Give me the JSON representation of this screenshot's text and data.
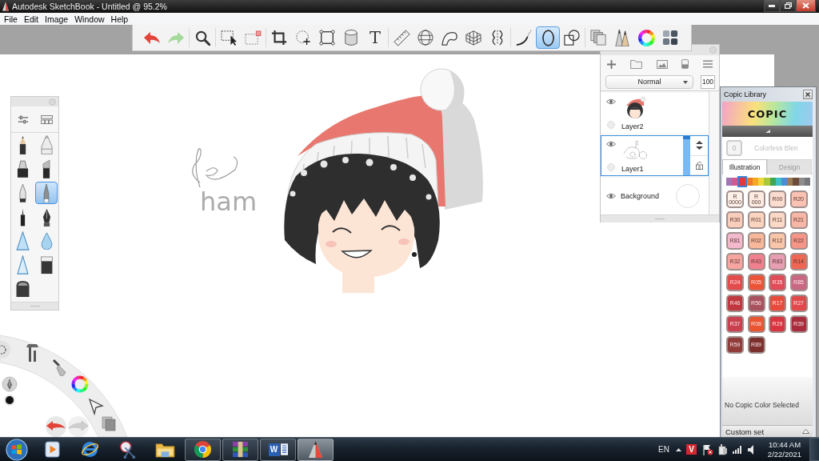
{
  "window": {
    "title": "Autodesk SketchBook - Untitled @ 95.2%"
  },
  "menu": [
    "File",
    "Edit",
    "Image",
    "Window",
    "Help"
  ],
  "toolbar": {
    "groups": [
      [
        {
          "selected": false
        },
        {
          "selected": false
        }
      ],
      [
        {
          "selected": false
        }
      ],
      [
        {
          "selected": false
        },
        {
          "selected": false
        }
      ],
      [
        {
          "selected": false
        },
        {
          "selected": false
        },
        {
          "selected": false
        },
        {
          "selected": false
        },
        {
          "glyph": "T",
          "selected": false
        }
      ],
      [
        {
          "selected": false
        },
        {
          "selected": false
        },
        {
          "selected": false
        },
        {
          "selected": false
        },
        {
          "selected": false
        }
      ],
      [
        {
          "selected": false
        },
        {
          "selected": true
        },
        {
          "selected": false
        }
      ],
      [
        {
          "selected": false
        },
        {
          "selected": false
        },
        {
          "selected": false
        },
        {
          "selected": false
        }
      ]
    ]
  },
  "canvas": {
    "handwriting": "ham"
  },
  "brush_palette": {
    "brushes": [
      {
        "selected": false
      },
      {
        "selected": false
      },
      {
        "selected": false
      },
      {
        "selected": false
      },
      {
        "selected": false
      },
      {
        "selected": true
      },
      {
        "selected": false
      },
      {
        "selected": false
      },
      {
        "selected": false
      },
      {
        "selected": false
      },
      {
        "selected": false
      },
      {
        "selected": false
      },
      {
        "selected": false
      }
    ]
  },
  "layers": {
    "blend_mode": "Normal",
    "opacity": "100",
    "items": [
      {
        "kind": "layer",
        "name": "Layer2",
        "selected": false
      },
      {
        "kind": "layer",
        "name": "Layer1",
        "selected": true
      },
      {
        "kind": "background",
        "name": "Background",
        "selected": false
      }
    ]
  },
  "copic_library": {
    "title": "Copic Library",
    "logo": "COPIC",
    "blender": {
      "code": "0",
      "name": "Colorless Blen",
      "disabled": true
    },
    "tabs": [
      {
        "label": "Illustration",
        "selected": true
      },
      {
        "label": "Design",
        "selected": false
      }
    ],
    "families": [
      {
        "color": "#a274b5",
        "selected": false
      },
      {
        "color": "#cf5b91",
        "selected": false
      },
      {
        "color": "#e2393f",
        "selected": true
      },
      {
        "color": "#f07a2a",
        "selected": false
      },
      {
        "color": "#f5a623",
        "selected": false
      },
      {
        "color": "#efd83a",
        "selected": false
      },
      {
        "color": "#a9c93c",
        "selected": false
      },
      {
        "color": "#3fa654",
        "selected": false
      },
      {
        "color": "#3cc0c6",
        "selected": false
      },
      {
        "color": "#4a8ed1",
        "selected": false
      },
      {
        "color": "#9b7c55",
        "selected": false
      },
      {
        "color": "#6d4b3a",
        "selected": false
      },
      {
        "color": "#8d8d8d",
        "selected": false
      },
      {
        "color": "#74787c",
        "selected": false
      }
    ],
    "swatches": [
      {
        "code": "R 0000",
        "color": "#fdf1ea"
      },
      {
        "code": "R 000",
        "color": "#fdebe2"
      },
      {
        "code": "R00",
        "color": "#fbdccf"
      },
      {
        "code": "R20",
        "color": "#f9c2b2"
      },
      {
        "code": "R30",
        "color": "#f8cdbb"
      },
      {
        "code": "R01",
        "color": "#fbd4bf"
      },
      {
        "code": "R11",
        "color": "#fcd9c7"
      },
      {
        "code": "R21",
        "color": "#f7b6a6"
      },
      {
        "code": "R81",
        "color": "#f2b8cc"
      },
      {
        "code": "R02",
        "color": "#f8b99b"
      },
      {
        "code": "R12",
        "color": "#f9c6aa"
      },
      {
        "code": "R22",
        "color": "#f49587"
      },
      {
        "code": "R32",
        "color": "#f6a5a1"
      },
      {
        "code": "R43",
        "color": "#f0808d"
      },
      {
        "code": "R83",
        "color": "#e79db2"
      },
      {
        "code": "R14",
        "color": "#ef6654"
      },
      {
        "code": "R24",
        "color": "#e34c4c"
      },
      {
        "code": "R05",
        "color": "#ec5337"
      },
      {
        "code": "R35",
        "color": "#e04c57"
      },
      {
        "code": "R85",
        "color": "#c86882"
      },
      {
        "code": "R46",
        "color": "#c0383f"
      },
      {
        "code": "R56",
        "color": "#a8525f"
      },
      {
        "code": "R17",
        "color": "#e64b3c"
      },
      {
        "code": "R27",
        "color": "#e0484c"
      },
      {
        "code": "R37",
        "color": "#c9414f"
      },
      {
        "code": "R08",
        "color": "#e95431"
      },
      {
        "code": "R29",
        "color": "#d83540"
      },
      {
        "code": "R39",
        "color": "#a92c3d"
      },
      {
        "code": "R59",
        "color": "#8f3c3b"
      },
      {
        "code": "R89",
        "color": "#7b302e"
      }
    ],
    "status": "No Copic Color Selected",
    "custom_set": "Custom set"
  },
  "taskbar": {
    "apps": [
      {
        "running": false,
        "selected": false
      },
      {
        "running": false,
        "selected": false
      },
      {
        "running": false,
        "selected": false
      },
      {
        "running": false,
        "selected": false
      },
      {
        "running": true,
        "selected": false
      },
      {
        "running": true,
        "selected": false
      },
      {
        "running": true,
        "selected": false,
        "glyph": "W"
      },
      {
        "running": true,
        "selected": true
      }
    ],
    "tray": {
      "language": "EN",
      "badge": "V",
      "time": "10:44 AM",
      "date": "2/22/2021"
    }
  }
}
